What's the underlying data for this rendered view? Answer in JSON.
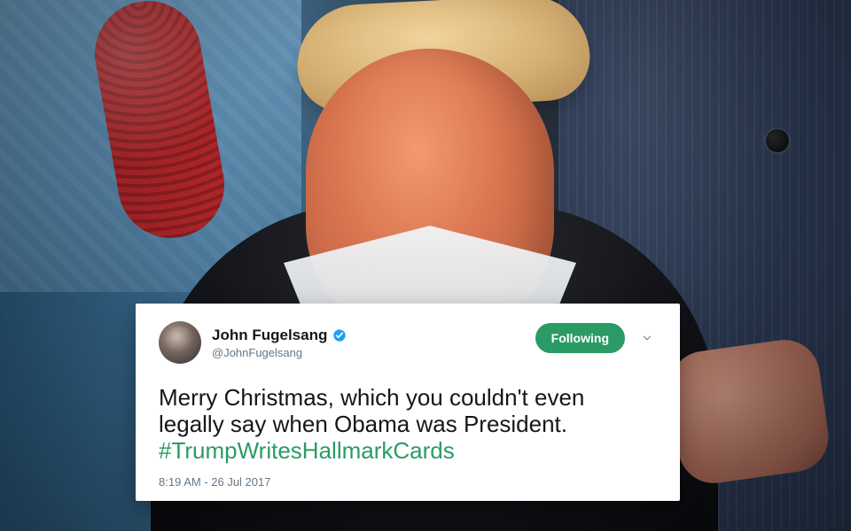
{
  "tweet": {
    "user": {
      "display_name": "John Fugelsang",
      "handle": "@JohnFugelsang",
      "verified_color": "#1DA1F2",
      "avatar_icon": "user-avatar-icon"
    },
    "follow_button": {
      "label": "Following",
      "color": "#2B9B65",
      "text_color": "#FFFFFF"
    },
    "menu_icon": "chevron-down-icon",
    "text": {
      "line1": "Merry Christmas, which you couldn't even",
      "line2": "legally say when Obama was President.",
      "hashtag": "#TrumpWritesHallmarkCards",
      "hashtag_color": "#2B9B65"
    },
    "timestamp": "8:19 AM - 26 Jul 2017"
  }
}
